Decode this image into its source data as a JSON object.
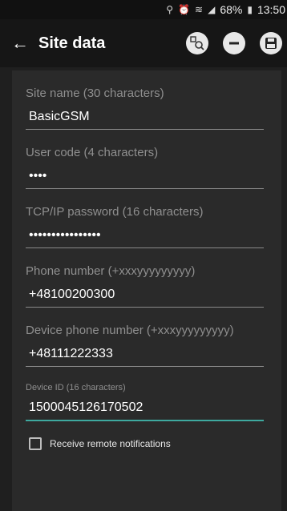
{
  "status": {
    "icons": [
      "location-icon",
      "alarm-icon",
      "wifi-icon",
      "signal-icon"
    ],
    "battery": "68%",
    "time": "13:50"
  },
  "toolbar": {
    "title": "Site data"
  },
  "fields": [
    {
      "label": "Site name (30 characters)",
      "value": "BasicGSM"
    },
    {
      "label": "User code (4 characters)",
      "value": "••••"
    },
    {
      "label": "TCP/IP password (16 characters)",
      "value": "••••••••••••••••"
    },
    {
      "label": "Phone number (+xxxyyyyyyyyy)",
      "value": "+48100200300"
    },
    {
      "label": "Device phone number (+xxxyyyyyyyyy)",
      "value": "+48111222333"
    },
    {
      "label": "Device ID (16 characters)",
      "value": "1500045126170502"
    }
  ],
  "checkbox": {
    "label": "Receive remote notifications",
    "checked": false
  },
  "colors": {
    "accent": "#3ea99f",
    "background": "#1f1f1f",
    "panel": "#2a2a2a"
  }
}
